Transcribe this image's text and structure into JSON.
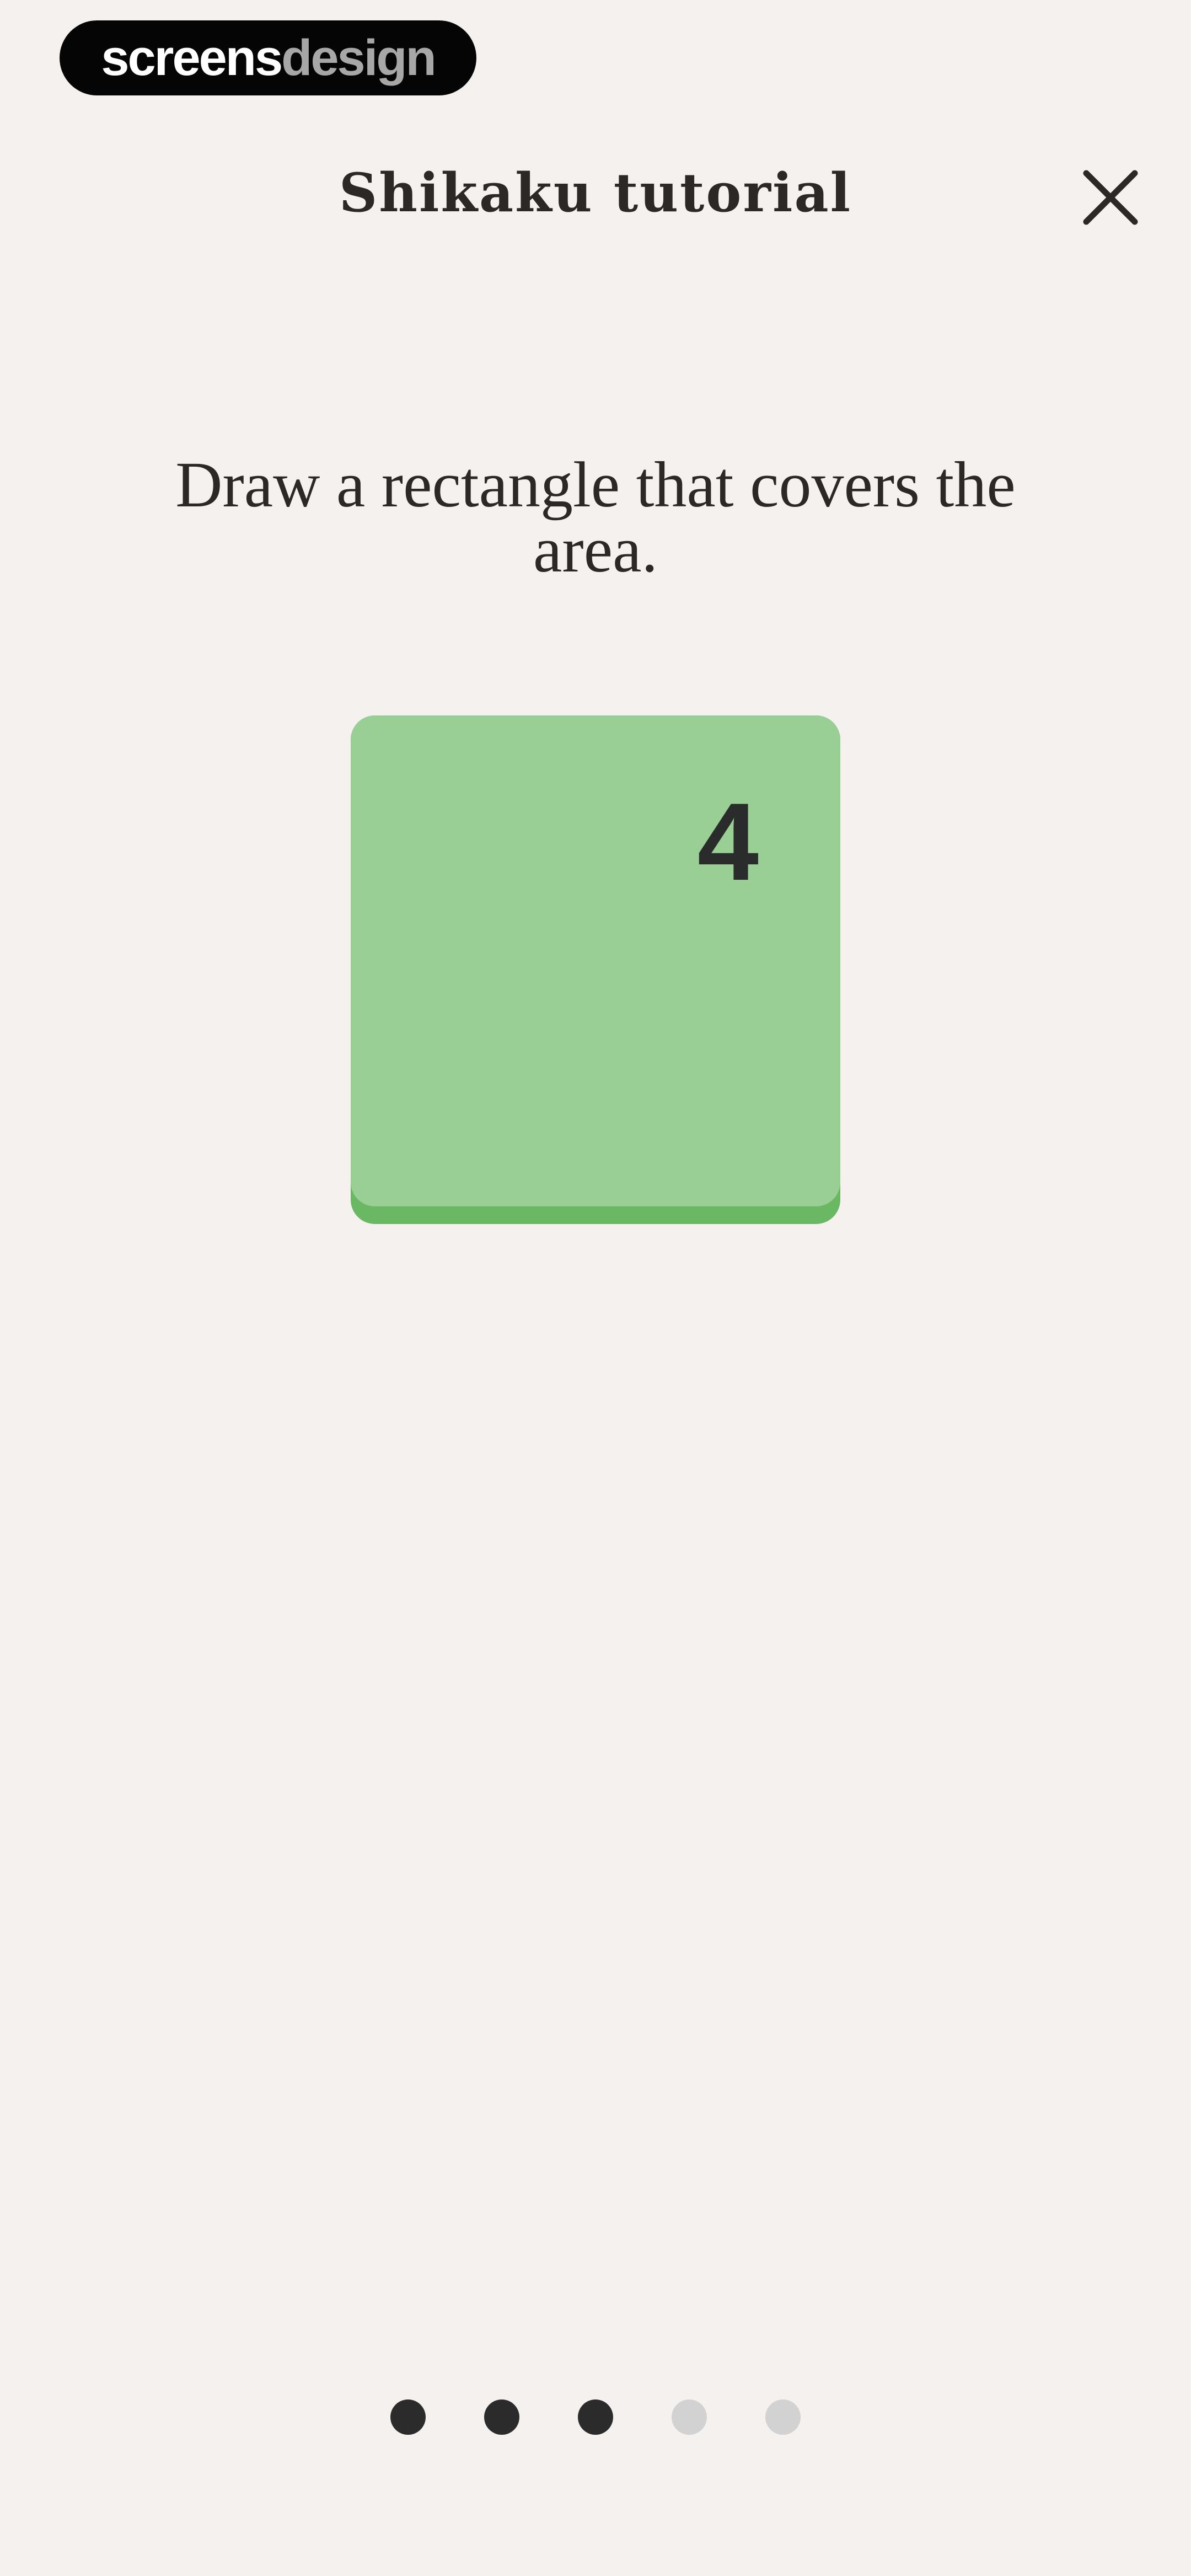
{
  "watermark": {
    "part1": "screens",
    "part2": "design"
  },
  "header": {
    "title": "Shikaku tutorial",
    "close_icon": "close-icon"
  },
  "tutorial": {
    "instruction": "Draw a rectangle that covers the area.",
    "tile_number": "4",
    "colors": {
      "tile_face": "#99ce94",
      "tile_edge": "#6ab764"
    }
  },
  "pagination": {
    "total": 5,
    "current": 3,
    "active_color": "#2b2b2b",
    "inactive_color": "#d2d2d2"
  }
}
